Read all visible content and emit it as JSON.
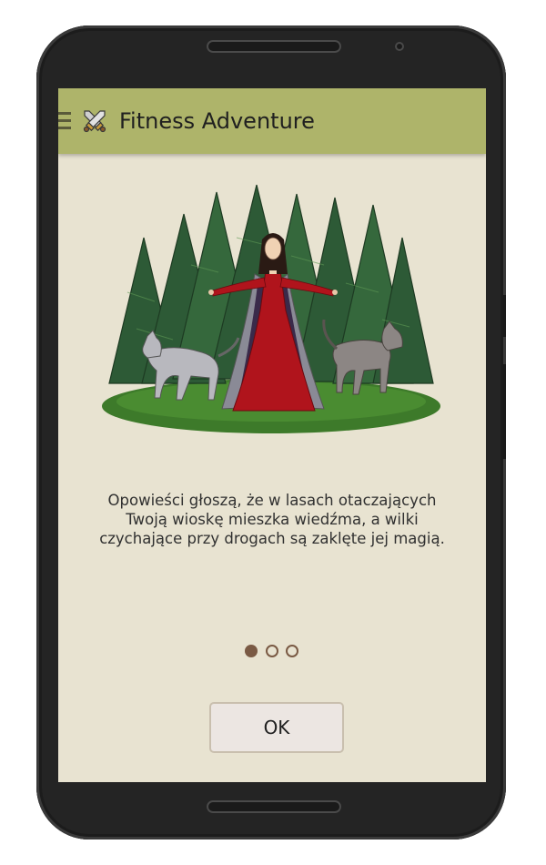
{
  "app": {
    "title": "Fitness Adventure",
    "accent_color": "#aeb46a",
    "background_color": "#e8e3d1"
  },
  "icons": {
    "menu": "hamburger-menu-icon",
    "logo": "crossed-swords-icon"
  },
  "story": {
    "lines": [
      "Opowieści głoszą, że w lasach otaczających",
      "Twoją wioskę mieszka wiedźma, a wilki",
      "czychające przy drogach są zaklęte jej magią."
    ]
  },
  "pager": {
    "pages": 3,
    "current": 1
  },
  "actions": {
    "ok_label": "OK"
  }
}
